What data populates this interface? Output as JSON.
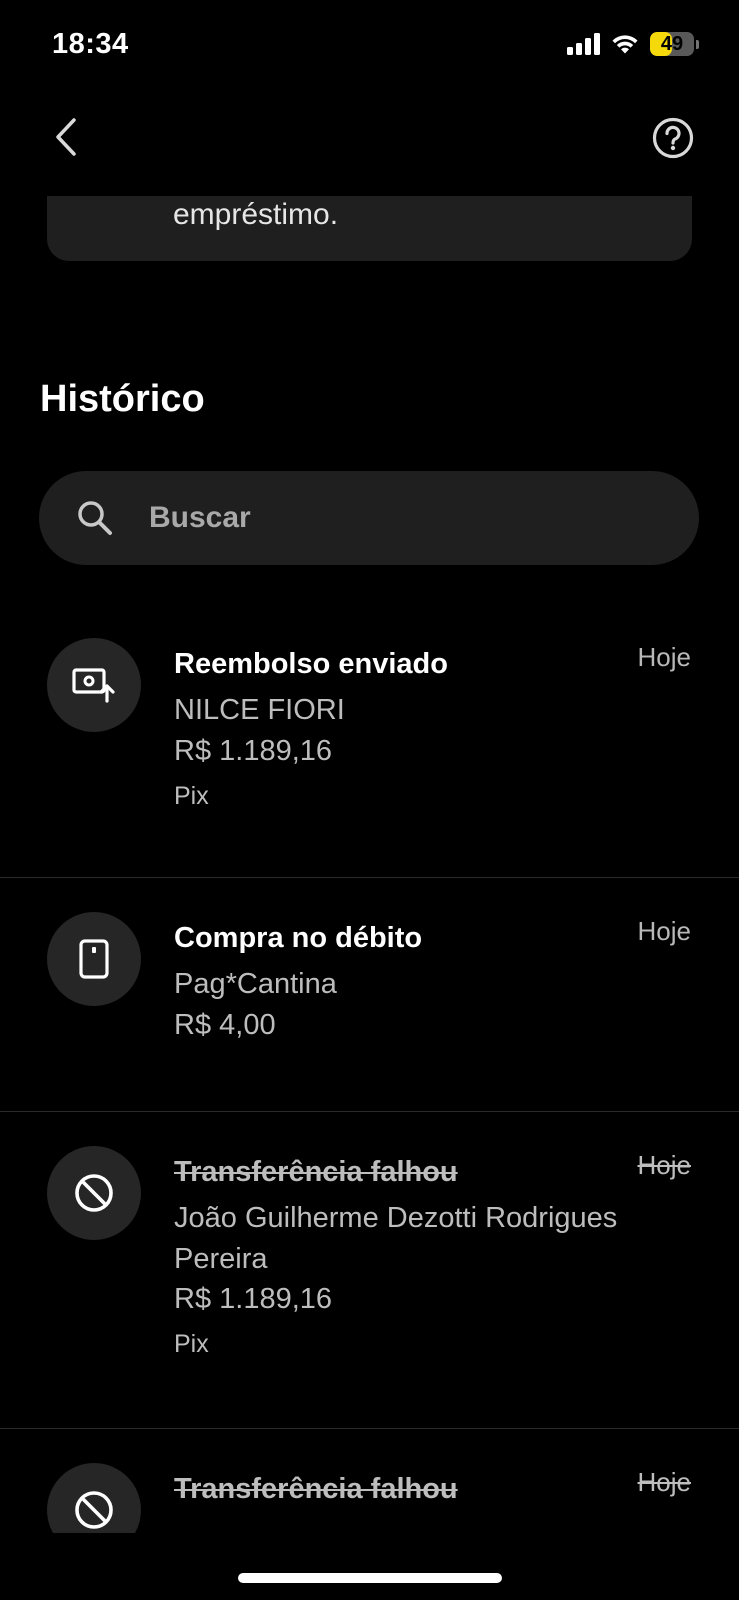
{
  "status_bar": {
    "time": "18:34",
    "battery": "49",
    "battery_level": 0.49
  },
  "previous_card": {
    "text": "empréstimo."
  },
  "history": {
    "title": "Histórico"
  },
  "search": {
    "placeholder": "Buscar",
    "value": ""
  },
  "transactions": [
    {
      "icon": "cash-upload-icon",
      "title": "Reembolso enviado",
      "date": "Hoje",
      "counterparty": "NILCE FIORI",
      "amount": "R$ 1.189,16",
      "method": "Pix",
      "failed": false
    },
    {
      "icon": "card-icon",
      "title": "Compra no débito",
      "date": "Hoje",
      "counterparty": "Pag*Cantina",
      "amount": "R$ 4,00",
      "method": "",
      "failed": false
    },
    {
      "icon": "blocked-icon",
      "title": "Transferência falhou",
      "date": "Hoje",
      "counterparty": "João Guilherme Dezotti Rodrigues Pereira",
      "amount": "R$ 1.189,16",
      "method": "Pix",
      "failed": true
    },
    {
      "icon": "blocked-icon",
      "title": "Transferência falhou",
      "date": "Hoje",
      "failed": true
    }
  ],
  "colors": {
    "background": "#000000",
    "surface": "#1f1f1f",
    "battery": "#f5d90a"
  }
}
